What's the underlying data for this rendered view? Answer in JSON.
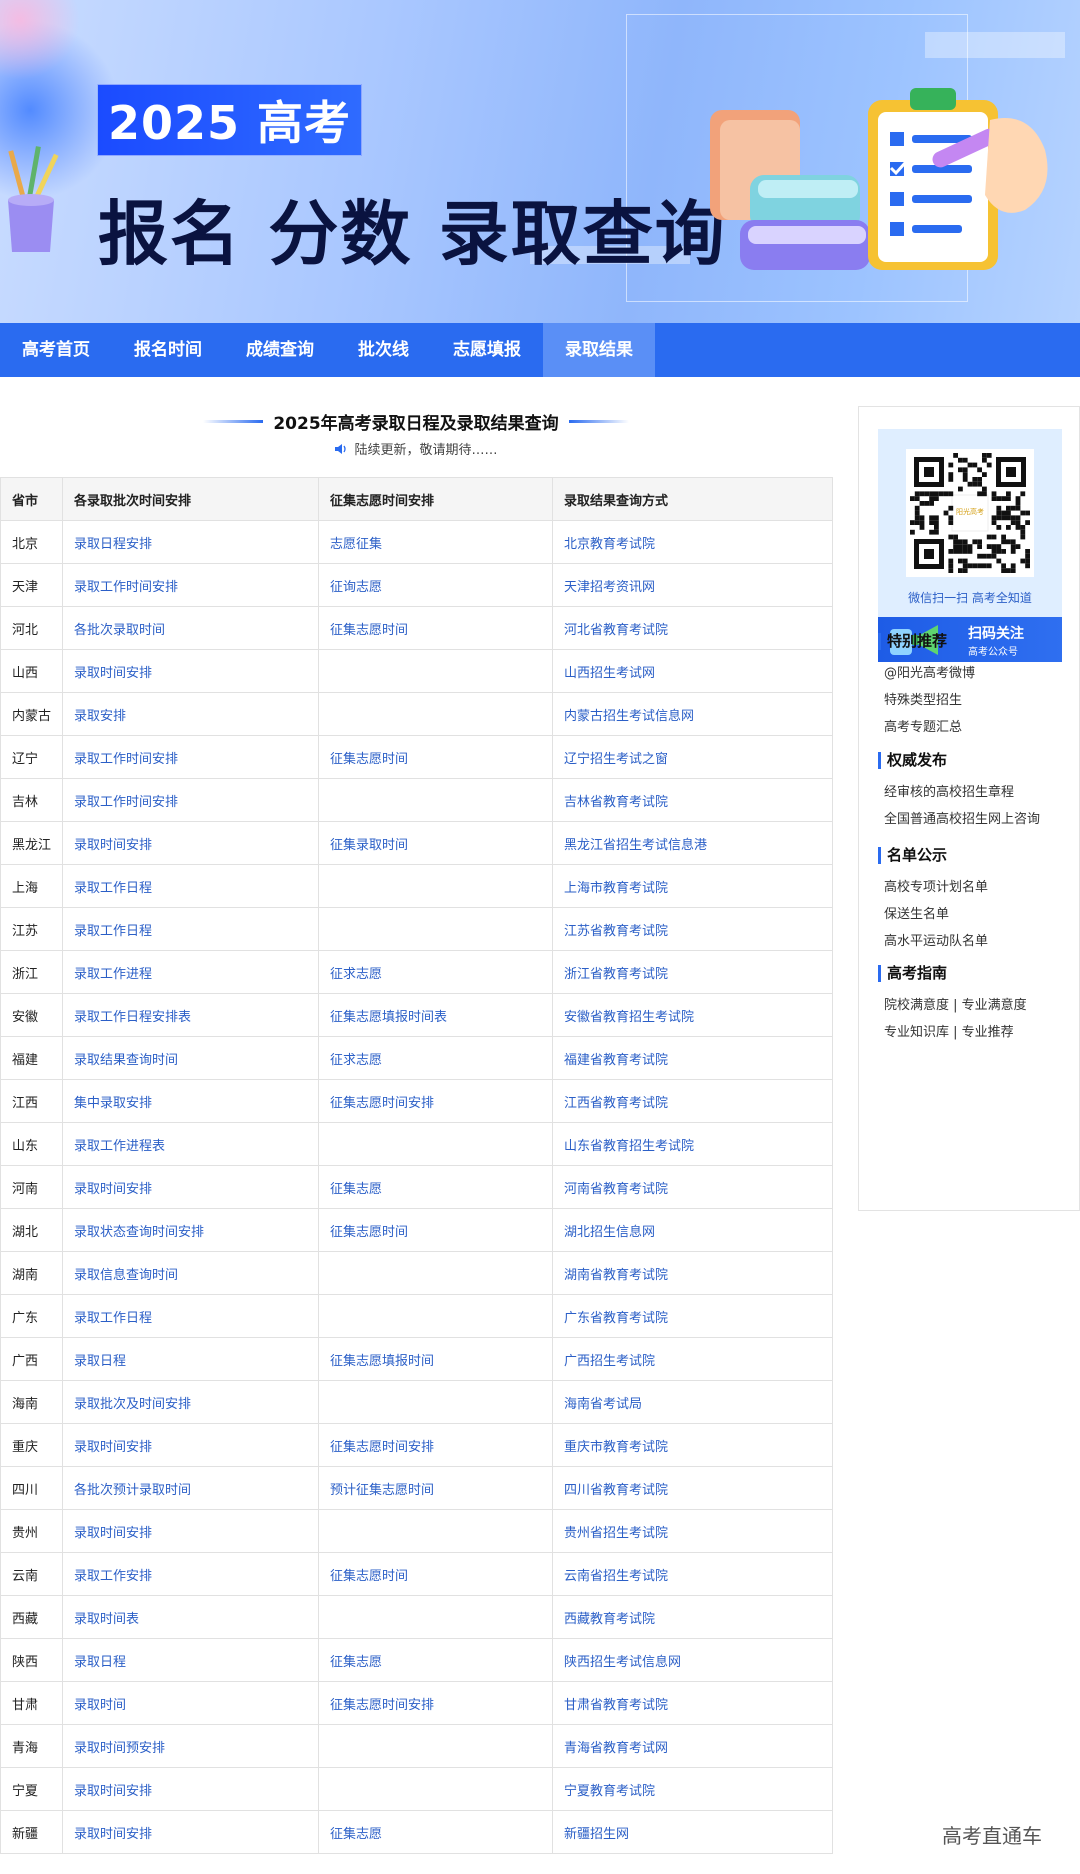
{
  "banner": {
    "badge": "2025 高考",
    "headline": "报名 分数 录取查询"
  },
  "nav": {
    "items": [
      "高考首页",
      "报名时间",
      "成绩查询",
      "批次线",
      "志愿填报",
      "录取结果"
    ],
    "active_index": 5
  },
  "main": {
    "title": "2025年高考录取日程及录取结果查询",
    "subtitle": "陆续更新，敬请期待……",
    "table": {
      "headers": [
        "省市",
        "各录取批次时间安排",
        "征集志愿时间安排",
        "录取结果查询方式"
      ],
      "rows": [
        [
          "北京",
          "录取日程安排",
          "志愿征集",
          "北京教育考试院"
        ],
        [
          "天津",
          "录取工作时间安排",
          "征询志愿",
          "天津招考资讯网"
        ],
        [
          "河北",
          "各批次录取时间",
          "征集志愿时间",
          "河北省教育考试院"
        ],
        [
          "山西",
          "录取时间安排",
          "",
          "山西招生考试网"
        ],
        [
          "内蒙古",
          "录取安排",
          "",
          "内蒙古招生考试信息网"
        ],
        [
          "辽宁",
          "录取工作时间安排",
          "征集志愿时间",
          "辽宁招生考试之窗"
        ],
        [
          "吉林",
          "录取工作时间安排",
          "",
          "吉林省教育考试院"
        ],
        [
          "黑龙江",
          "录取时间安排",
          "征集录取时间",
          "黑龙江省招生考试信息港"
        ],
        [
          "上海",
          "录取工作日程",
          "",
          "上海市教育考试院"
        ],
        [
          "江苏",
          "录取工作日程",
          "",
          "江苏省教育考试院"
        ],
        [
          "浙江",
          "录取工作进程",
          "征求志愿",
          "浙江省教育考试院"
        ],
        [
          "安徽",
          "录取工作日程安排表",
          "征集志愿填报时间表",
          "安徽省教育招生考试院"
        ],
        [
          "福建",
          "录取结果查询时间",
          "征求志愿",
          "福建省教育考试院"
        ],
        [
          "江西",
          "集中录取安排",
          "征集志愿时间安排",
          "江西省教育考试院"
        ],
        [
          "山东",
          "录取工作进程表",
          "",
          "山东省教育招生考试院"
        ],
        [
          "河南",
          "录取时间安排",
          "征集志愿",
          "河南省教育考试院"
        ],
        [
          "湖北",
          "录取状态查询时间安排",
          "征集志愿时间",
          "湖北招生信息网"
        ],
        [
          "湖南",
          "录取信息查询时间",
          "",
          "湖南省教育考试院"
        ],
        [
          "广东",
          "录取工作日程",
          "",
          "广东省教育考试院"
        ],
        [
          "广西",
          "录取日程",
          "征集志愿填报时间",
          "广西招生考试院"
        ],
        [
          "海南",
          "录取批次及时间安排",
          "",
          "海南省考试局"
        ],
        [
          "重庆",
          "录取时间安排",
          "征集志愿时间安排",
          "重庆市教育考试院"
        ],
        [
          "四川",
          "各批次预计录取时间",
          "预计征集志愿时间",
          "四川省教育考试院"
        ],
        [
          "贵州",
          "录取时间安排",
          "",
          "贵州省招生考试院"
        ],
        [
          "云南",
          "录取工作安排",
          "征集志愿时间",
          "云南省招生考试院"
        ],
        [
          "西藏",
          "录取时间表",
          "",
          "西藏教育考试院"
        ],
        [
          "陕西",
          "录取日程",
          "征集志愿",
          "陕西招生考试信息网"
        ],
        [
          "甘肃",
          "录取时间",
          "征集志愿时间安排",
          "甘肃省教育考试院"
        ],
        [
          "青海",
          "录取时间预安排",
          "",
          "青海省教育考试网"
        ],
        [
          "宁夏",
          "录取时间安排",
          "",
          "宁夏教育考试院"
        ],
        [
          "新疆",
          "录取时间安排",
          "征集志愿",
          "新疆招生网"
        ]
      ]
    }
  },
  "sidebar": {
    "qr_logo_text": "阳光高考",
    "qr_caption": "微信扫一扫  高考全知道",
    "qr_button_main": "扫码关注",
    "qr_button_sub": "高考公众号",
    "sections": [
      {
        "title": "特别推荐",
        "items": [
          "@阳光高考微博",
          "特殊类型招生",
          "高考专题汇总"
        ]
      },
      {
        "title": "权威发布",
        "items": [
          "经审核的高校招生章程",
          "全国普通高校招生网上咨询"
        ]
      },
      {
        "title": "名单公示",
        "items": [
          "高校专项计划名单",
          "保送生名单",
          "高水平运动队名单"
        ]
      },
      {
        "title": "高考指南",
        "items": [
          "院校满意度 | 专业满意度",
          "专业知识库 | 专业推荐"
        ]
      }
    ]
  },
  "watermark": "高考直通车",
  "colors": {
    "nav_bg": "#2a6bf0",
    "nav_active": "#5a8ff6",
    "link": "#2b5fc7",
    "badge_bg": "#1b4bff",
    "headline": "#0a1340"
  }
}
